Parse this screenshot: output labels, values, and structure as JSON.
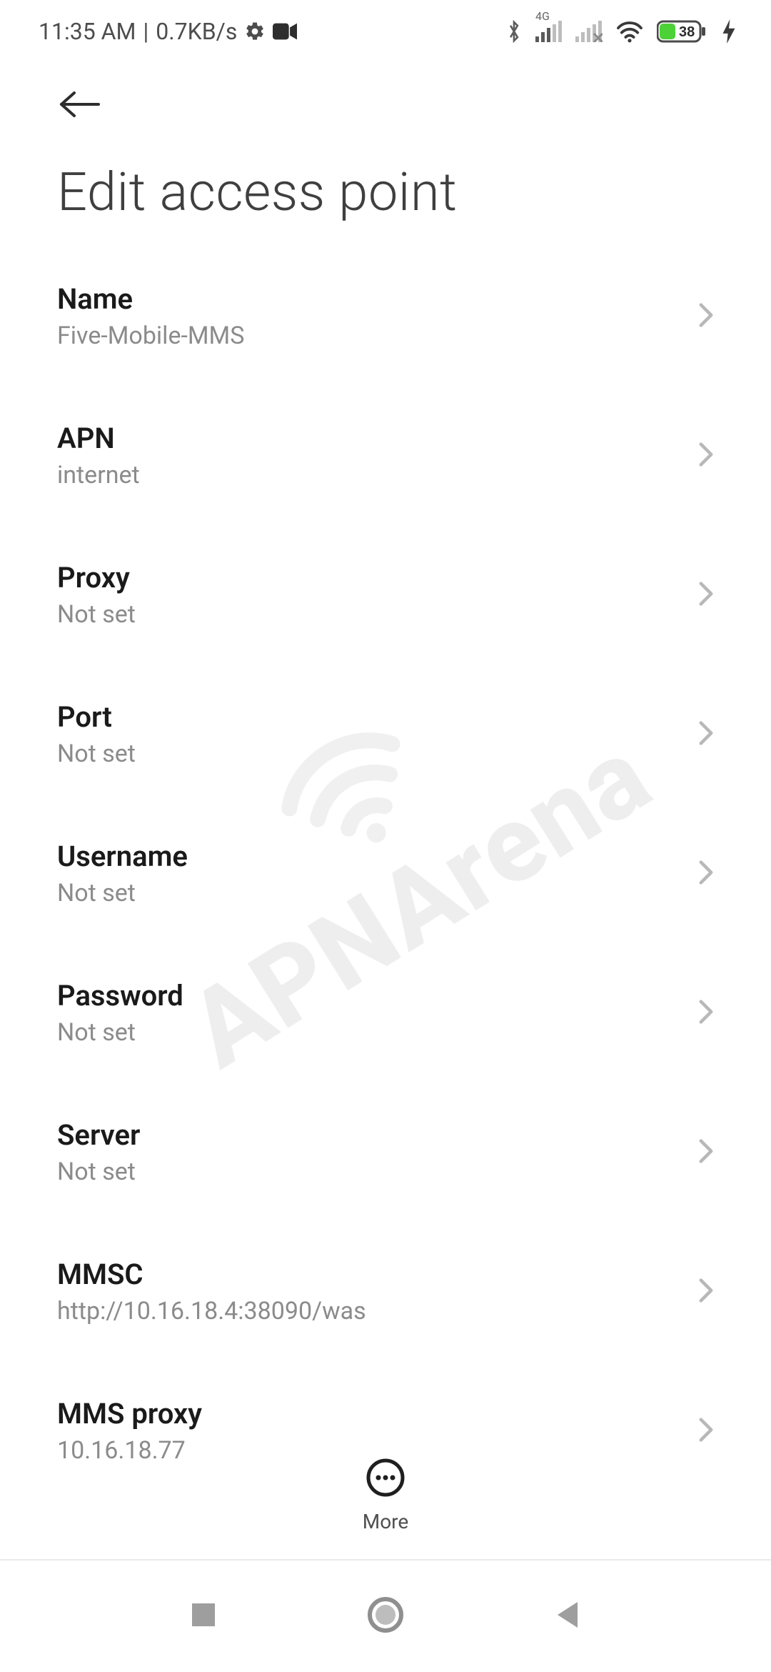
{
  "status_bar": {
    "time": "11:35 AM",
    "separator": "|",
    "data_rate": "0.7KB/s",
    "network_badge": "4G",
    "battery_percent": "38"
  },
  "header": {
    "title": "Edit access point"
  },
  "settings": [
    {
      "label": "Name",
      "value": "Five-Mobile-MMS"
    },
    {
      "label": "APN",
      "value": "internet"
    },
    {
      "label": "Proxy",
      "value": "Not set"
    },
    {
      "label": "Port",
      "value": "Not set"
    },
    {
      "label": "Username",
      "value": "Not set"
    },
    {
      "label": "Password",
      "value": "Not set"
    },
    {
      "label": "Server",
      "value": "Not set"
    },
    {
      "label": "MMSC",
      "value": "http://10.16.18.4:38090/was"
    },
    {
      "label": "MMS proxy",
      "value": "10.16.18.77"
    }
  ],
  "watermark": "APNArena",
  "more_button": {
    "label": "More"
  }
}
